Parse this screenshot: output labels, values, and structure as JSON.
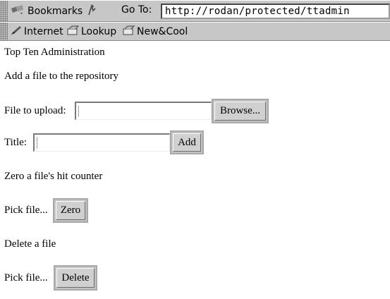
{
  "toolbar": {
    "bookmarks_label": "Bookmarks",
    "goto_label": "Go To:",
    "location_url": "http://rodan/protected/ttadmin",
    "links": [
      {
        "label": "Internet",
        "icon": "pen-icon"
      },
      {
        "label": "Lookup",
        "icon": "folder-icon"
      },
      {
        "label": "New&Cool",
        "icon": "folder-icon"
      }
    ]
  },
  "page": {
    "heading": "Top Ten Administration",
    "add_section": "Add a file to the repository",
    "file_label": "File to upload:",
    "browse_button": "Browse...",
    "title_label": "Title:",
    "add_button": "Add",
    "zero_section": "Zero a file's hit counter",
    "pick_label_zero": "Pick file...",
    "zero_button": "Zero",
    "delete_section": "Delete a file",
    "pick_label_delete": "Pick file...",
    "delete_button": "Delete"
  }
}
